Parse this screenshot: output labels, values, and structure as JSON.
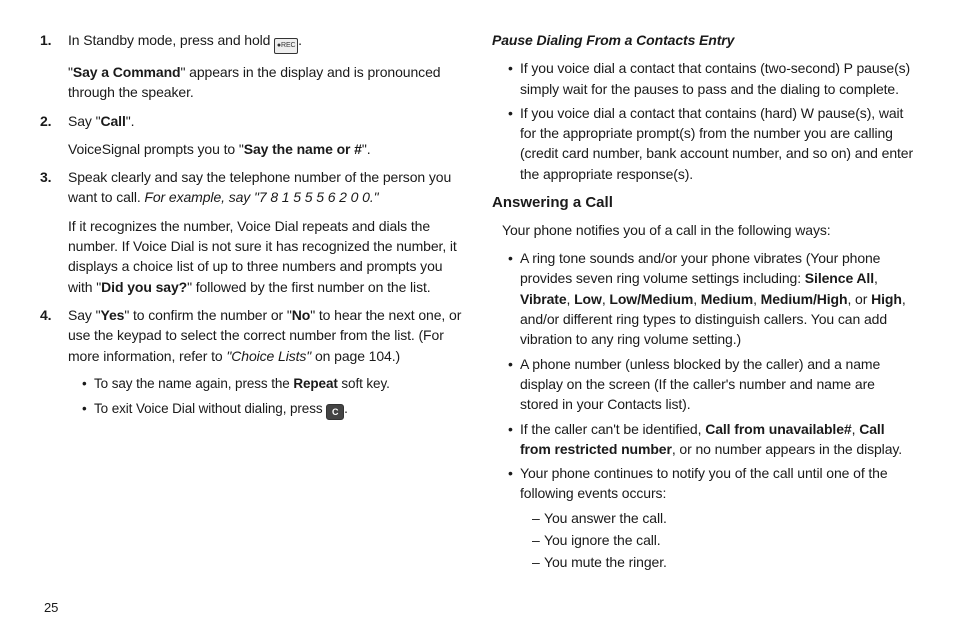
{
  "page_number": "25",
  "left": {
    "steps": [
      {
        "n": "1.",
        "lines": [
          [
            {
              "t": "In Standby mode, press and hold "
            },
            {
              "icon": "rec-key"
            },
            {
              "t": "."
            }
          ],
          [
            {
              "t": "\""
            },
            {
              "b": "Say a Command"
            },
            {
              "t": "\" appears in the display and is pronounced through the speaker."
            }
          ]
        ]
      },
      {
        "n": "2.",
        "lines": [
          [
            {
              "t": "Say \""
            },
            {
              "b": "Call"
            },
            {
              "t": "\"."
            }
          ],
          [
            {
              "t": "VoiceSignal prompts you to \""
            },
            {
              "b": "Say the name or #"
            },
            {
              "t": "\"."
            }
          ]
        ]
      },
      {
        "n": "3.",
        "lines": [
          [
            {
              "t": "Speak clearly and say the telephone number of the person you want to call. "
            },
            {
              "i": "For example, say \"7 8 1 5 5 5 6 2 0 0.\""
            }
          ],
          [
            {
              "t": "If it recognizes the number, Voice Dial repeats and dials the number. If Voice Dial is not sure it has recognized the number, it displays a choice list of up to three numbers and prompts you with \""
            },
            {
              "b": "Did you say?"
            },
            {
              "t": "\" followed by the first number on the list."
            }
          ]
        ]
      },
      {
        "n": "4.",
        "lines": [
          [
            {
              "t": "Say \""
            },
            {
              "b": "Yes"
            },
            {
              "t": "\" to confirm the number or \""
            },
            {
              "b": "No"
            },
            {
              "t": "\" to hear the next one, or use the keypad to select the correct number from the list. (For more information, refer to "
            },
            {
              "i": "\"Choice Lists\" "
            },
            {
              "t": " on page 104.)"
            }
          ]
        ],
        "subbul": [
          [
            {
              "t": "To say the name again, press the "
            },
            {
              "b": "Repeat"
            },
            {
              "t": " soft key."
            }
          ],
          [
            {
              "t": "To exit Voice Dial without dialing, press "
            },
            {
              "icon": "c-key"
            },
            {
              "t": "."
            }
          ]
        ]
      }
    ]
  },
  "right": {
    "pause_heading": "Pause Dialing From a Contacts Entry",
    "pause_items": [
      [
        {
          "t": "If you voice dial a contact that contains (two-second) P pause(s) simply wait for the pauses to pass and the dialing to complete."
        }
      ],
      [
        {
          "t": "If you voice dial a contact that contains (hard) W pause(s), wait for the appropriate prompt(s) from the number you are calling (credit card number, bank account number, and so on) and enter the appropriate response(s)."
        }
      ]
    ],
    "answer_heading": "Answering a Call",
    "answer_intro": "Your phone notifies you of a call in the following ways:",
    "answer_items": [
      [
        {
          "t": "A ring tone sounds and/or your phone vibrates (Your phone provides seven ring volume settings including: "
        },
        {
          "b": "Silence All"
        },
        {
          "t": ", "
        },
        {
          "b": "Vibrate"
        },
        {
          "t": ", "
        },
        {
          "b": "Low"
        },
        {
          "t": ", "
        },
        {
          "b": "Low/Medium"
        },
        {
          "t": ", "
        },
        {
          "b": "Medium"
        },
        {
          "t": ", "
        },
        {
          "b": "Medium/High"
        },
        {
          "t": ", or "
        },
        {
          "b": "High"
        },
        {
          "t": ", and/or different ring types to distinguish callers. You can add vibration to any ring volume setting.)"
        }
      ],
      [
        {
          "t": "A phone number (unless blocked by the caller) and a name display on the screen (If the caller's number and name are stored in your Contacts list)."
        }
      ],
      [
        {
          "t": "If the caller can't be identified, "
        },
        {
          "b": "Call from unavailable#"
        },
        {
          "t": ", "
        },
        {
          "b": "Call from restricted number"
        },
        {
          "t": ", or no number appears in the display."
        }
      ],
      [
        {
          "t": "Your phone continues to notify you of the call until one of the following events occurs:"
        }
      ]
    ],
    "answer_sub": [
      "You answer the call.",
      "You ignore the call.",
      "You mute the ringer."
    ]
  }
}
